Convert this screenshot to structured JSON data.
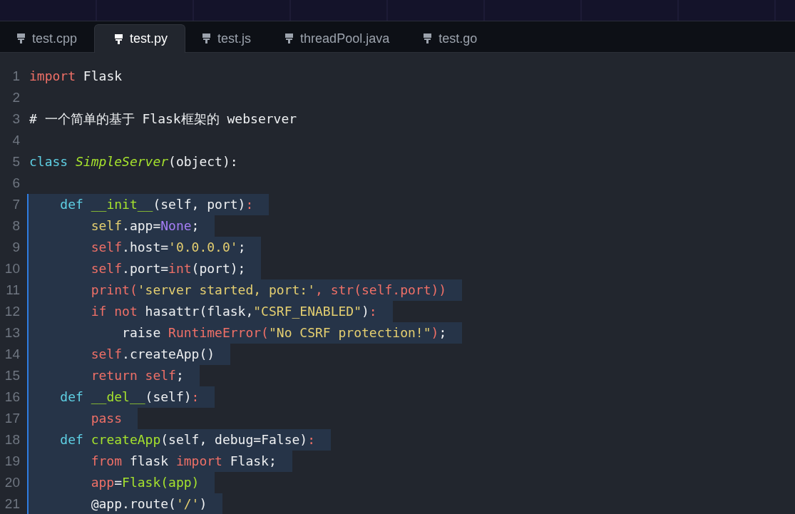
{
  "tabs": [
    {
      "label": "test.cpp",
      "selected": false
    },
    {
      "label": "test.py",
      "selected": true
    },
    {
      "label": "test.js",
      "selected": false
    },
    {
      "label": "threadPool.java",
      "selected": false
    },
    {
      "label": "test.go",
      "selected": false
    }
  ],
  "editor": {
    "lines": [
      {
        "number": "1",
        "selected": false,
        "tokens": [
          {
            "text": "import",
            "kind": "kw"
          },
          {
            "text": " Flask",
            "kind": "plain"
          }
        ]
      },
      {
        "number": "2",
        "selected": false
      },
      {
        "number": "3",
        "selected": false,
        "tokens": [
          {
            "text": "# 一个简单的基于 Flask框架的 webserver",
            "kind": "plain"
          }
        ]
      },
      {
        "number": "4",
        "selected": false
      },
      {
        "number": "5",
        "selected": false,
        "tokens": [
          {
            "text": "class ",
            "kind": "def"
          },
          {
            "text": "SimpleServer",
            "kind": "cls"
          },
          {
            "text": "(object):",
            "kind": "plain"
          }
        ]
      },
      {
        "number": "6",
        "selected": false
      },
      {
        "number": "7",
        "selected": true,
        "tokens": [
          {
            "text": "    def ",
            "kind": "def"
          },
          {
            "text": "__init__",
            "kind": "fn"
          },
          {
            "text": "(self, port)",
            "kind": "plain"
          },
          {
            "text": ":",
            "kind": "kw"
          }
        ]
      },
      {
        "number": "8",
        "selected": true,
        "tokens": [
          {
            "text": "        self",
            "kind": "str"
          },
          {
            "text": ".app=",
            "kind": "plain"
          },
          {
            "text": "None",
            "kind": "const"
          },
          {
            "text": ";",
            "kind": "plain"
          }
        ]
      },
      {
        "number": "9",
        "selected": true,
        "tokens": [
          {
            "text": "        self",
            "kind": "kw"
          },
          {
            "text": ".host=",
            "kind": "plain"
          },
          {
            "text": "'0.0.0.0'",
            "kind": "str"
          },
          {
            "text": ";",
            "kind": "plain"
          }
        ]
      },
      {
        "number": "10",
        "selected": true,
        "tokens": [
          {
            "text": "        self",
            "kind": "kw"
          },
          {
            "text": ".port=",
            "kind": "plain"
          },
          {
            "text": "int",
            "kind": "kw"
          },
          {
            "text": "(port);",
            "kind": "plain"
          }
        ]
      },
      {
        "number": "11",
        "selected": true,
        "tokens": [
          {
            "text": "        print(",
            "kind": "kw"
          },
          {
            "text": "'server started, port:'",
            "kind": "str"
          },
          {
            "text": ", str(self.port))",
            "kind": "kw"
          }
        ]
      },
      {
        "number": "12",
        "selected": true,
        "tokens": [
          {
            "text": "        if not",
            "kind": "kw"
          },
          {
            "text": " hasattr(flask,",
            "kind": "plain"
          },
          {
            "text": "\"CSRF_ENABLED\"",
            "kind": "str"
          },
          {
            "text": ")",
            "kind": "plain"
          },
          {
            "text": ":",
            "kind": "kw"
          }
        ]
      },
      {
        "number": "13",
        "selected": true,
        "tokens": [
          {
            "text": "            raise ",
            "kind": "plain"
          },
          {
            "text": "RuntimeError(",
            "kind": "kw"
          },
          {
            "text": "\"No CSRF protection!\"",
            "kind": "str"
          },
          {
            "text": ")",
            "kind": "kw"
          },
          {
            "text": ";",
            "kind": "plain"
          }
        ]
      },
      {
        "number": "14",
        "selected": true,
        "tokens": [
          {
            "text": "        self",
            "kind": "kw"
          },
          {
            "text": ".createApp()",
            "kind": "plain"
          }
        ]
      },
      {
        "number": "15",
        "selected": true,
        "tokens": [
          {
            "text": "        return self",
            "kind": "kw"
          },
          {
            "text": ";",
            "kind": "plain"
          }
        ]
      },
      {
        "number": "16",
        "selected": true,
        "tokens": [
          {
            "text": "    def ",
            "kind": "def"
          },
          {
            "text": "__del__",
            "kind": "fn"
          },
          {
            "text": "(self)",
            "kind": "plain"
          },
          {
            "text": ":",
            "kind": "kw"
          }
        ]
      },
      {
        "number": "17",
        "selected": true,
        "tokens": [
          {
            "text": "        pass",
            "kind": "kw"
          }
        ]
      },
      {
        "number": "18",
        "selected": true,
        "tokens": [
          {
            "text": "    def ",
            "kind": "def"
          },
          {
            "text": "createApp",
            "kind": "fn"
          },
          {
            "text": "(self, debug=False)",
            "kind": "plain"
          },
          {
            "text": ":",
            "kind": "kw"
          }
        ]
      },
      {
        "number": "19",
        "selected": true,
        "tokens": [
          {
            "text": "        from",
            "kind": "kw"
          },
          {
            "text": " flask ",
            "kind": "plain"
          },
          {
            "text": "import",
            "kind": "kw"
          },
          {
            "text": " Flask;",
            "kind": "plain"
          }
        ]
      },
      {
        "number": "20",
        "selected": true,
        "tokens": [
          {
            "text": "        app",
            "kind": "kw"
          },
          {
            "text": "=",
            "kind": "plain"
          },
          {
            "text": "Flask(app)",
            "kind": "fn"
          }
        ]
      },
      {
        "number": "21",
        "selected": true,
        "tokens": [
          {
            "text": "        @app.route(",
            "kind": "plain"
          },
          {
            "text": "'/'",
            "kind": "str"
          },
          {
            "text": ")",
            "kind": "plain"
          }
        ]
      }
    ]
  }
}
